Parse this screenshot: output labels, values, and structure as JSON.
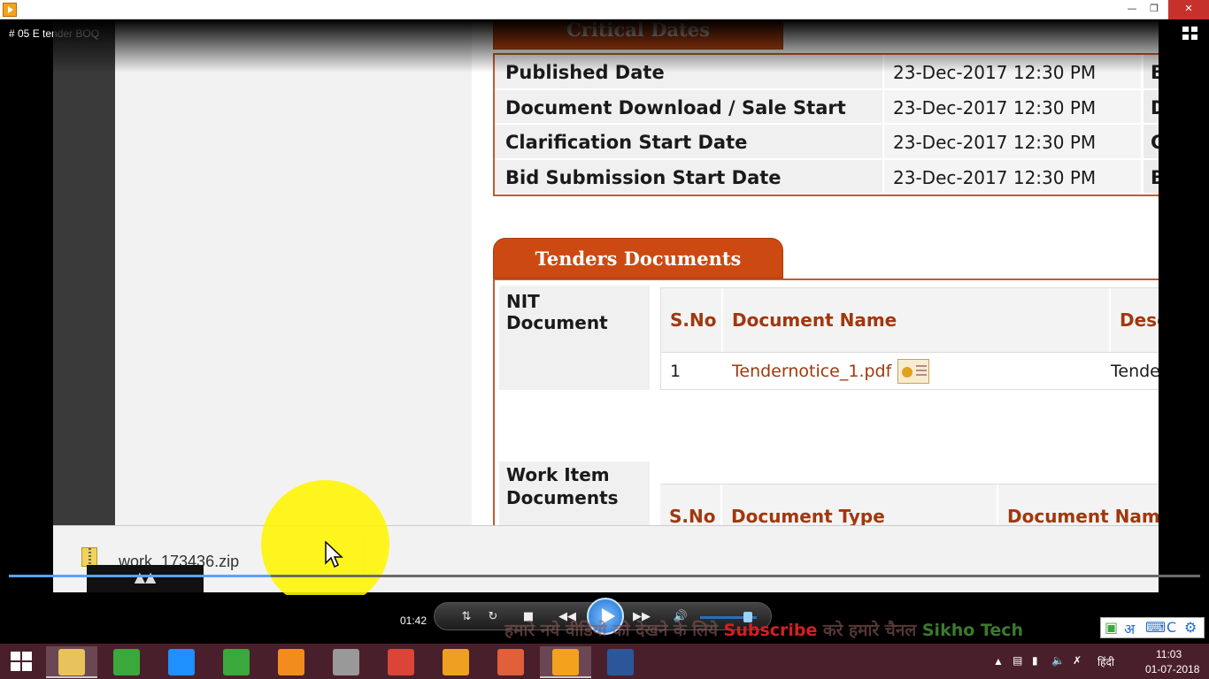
{
  "player": {
    "video_title": "# 05  E tender  BOQ",
    "current_time": "01:42",
    "progress": 0.22,
    "volume": 0.85
  },
  "critical_dates": {
    "tab_label": "Critical Dates",
    "rows": [
      {
        "label": "Published Date",
        "value": "23-Dec-2017 12:30 PM",
        "extra": "B"
      },
      {
        "label": "Document Download / Sale Start Date",
        "value": "23-Dec-2017 12:30 PM",
        "extra": "D"
      },
      {
        "label": "Clarification Start Date",
        "value": "23-Dec-2017 12:30 PM",
        "extra": "C"
      },
      {
        "label": "Bid Submission Start Date",
        "value": "23-Dec-2017 12:30 PM",
        "extra": "B"
      }
    ]
  },
  "tender_documents": {
    "tab_label": "Tenders Documents",
    "nit_label": "NIT Document",
    "nit_headers": [
      "S.No",
      "Document Name",
      "Desc"
    ],
    "nit_rows": [
      {
        "sno": "1",
        "name": "Tendernotice_1.pdf",
        "desc": "Tende"
      }
    ],
    "work_item_label": "Work Item Documents",
    "work_item_headers": [
      "S.No",
      "Document Type",
      "Document Name"
    ]
  },
  "download": {
    "file_name": "work_173436.zip"
  },
  "ticker": {
    "prefix": "हमारे नये  वीडियो को देखने के लिये ",
    "subscribe": "Subscribe",
    "middle": " करे हमारे चैनल ",
    "brand": "Sikho Tech"
  },
  "ime": {
    "script_char": "अ",
    "latin_char": "C"
  },
  "taskbar": {
    "apps": [
      {
        "name": "File Explorer",
        "color": "#e8c25a"
      },
      {
        "name": "Camtasia",
        "color": "#3aa83a"
      },
      {
        "name": "Internet Explorer",
        "color": "#1e90ff"
      },
      {
        "name": "Store",
        "color": "#3aa83a"
      },
      {
        "name": "VLC",
        "color": "#f28c1c"
      },
      {
        "name": "Network Tool",
        "color": "#999999"
      },
      {
        "name": "Chrome",
        "color": "#db4437"
      },
      {
        "name": "Audio",
        "color": "#f0a020"
      },
      {
        "name": "Recorder",
        "color": "#e0603a"
      },
      {
        "name": "Media Player",
        "color": "#f4a21d"
      },
      {
        "name": "Word",
        "color": "#2b579a"
      }
    ],
    "language": "हिंदी",
    "time": "11:03",
    "date": "01-07-2018"
  }
}
